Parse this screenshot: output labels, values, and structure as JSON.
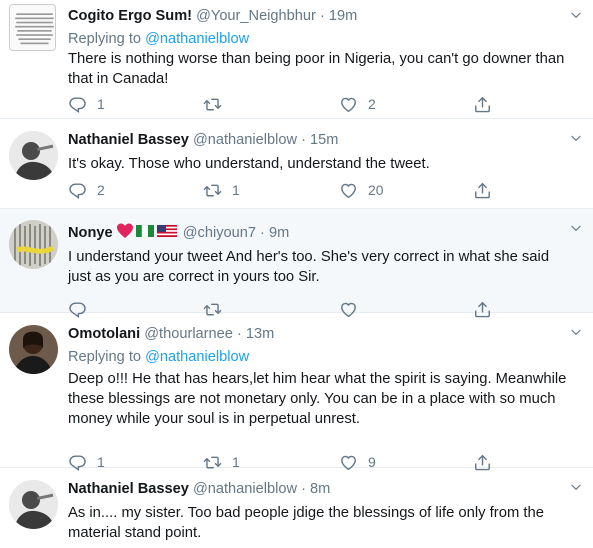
{
  "tweets": [
    {
      "name": "Cogito Ergo Sum!",
      "handle": "@Your_Neighbhur",
      "time": "19m",
      "replying_label": "Replying to",
      "replying_to": "@nathanielblow",
      "text_lines": [
        "There is nothing worse than being poor in Nigeria, you can't go downer than",
        "that in Canada!"
      ],
      "replies": "1",
      "retweets": "",
      "likes": "2"
    },
    {
      "name": "Nathaniel Bassey",
      "handle": "@nathanielblow",
      "time": "15m",
      "text_lines": [
        "It's okay. Those who understand, understand the tweet."
      ],
      "replies": "2",
      "retweets": "1",
      "likes": "20"
    },
    {
      "name": "Nonye",
      "handle": "@chiyoun7",
      "time": "9m",
      "text_lines": [
        "I understand your tweet And her's too. She's very correct in what she said",
        "just as you are correct in yours too Sir."
      ],
      "replies": "",
      "retweets": "",
      "likes": ""
    },
    {
      "name": "Omotolani",
      "handle": "@thourlarnee",
      "time": "13m",
      "replying_label": "Replying to",
      "replying_to": "@nathanielblow",
      "text_lines": [
        "Deep o!!! He that has hears,let him hear what the spirit is saying. Meanwhile",
        "these blessings are  not monetary only. You can be in a place with so much",
        "money while your soul is in perpetual unrest."
      ],
      "replies": "1",
      "retweets": "1",
      "likes": "9"
    },
    {
      "name": "Nathaniel Bassey",
      "handle": "@nathanielblow",
      "time": "8m",
      "text_lines": [
        "As in.... my sister. Too bad people jdige the blessings of life only from the",
        "material stand point."
      ]
    }
  ],
  "separator": "·",
  "icons": {
    "reply": "reply-icon",
    "retweet": "retweet-icon",
    "like": "heart-icon",
    "share": "share-icon",
    "caret": "chevron-down-icon"
  },
  "colors": {
    "link": "#1da1f2",
    "secondary": "#657786",
    "highlight_bg": "#f5f8fa",
    "heart_emoji": "#e0245e"
  }
}
